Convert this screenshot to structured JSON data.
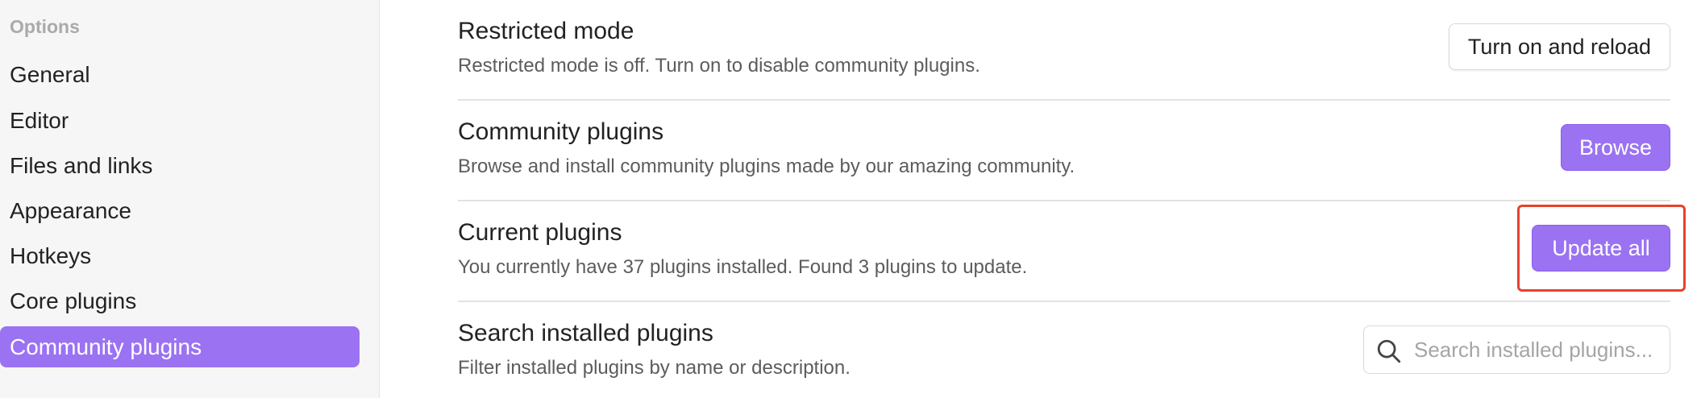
{
  "sidebar": {
    "heading": "Options",
    "items": [
      {
        "label": "General"
      },
      {
        "label": "Editor"
      },
      {
        "label": "Files and links"
      },
      {
        "label": "Appearance"
      },
      {
        "label": "Hotkeys"
      },
      {
        "label": "Core plugins"
      },
      {
        "label": "Community plugins",
        "active": true
      }
    ]
  },
  "settings": {
    "restricted_mode": {
      "title": "Restricted mode",
      "description": "Restricted mode is off. Turn on to disable community plugins.",
      "button_label": "Turn on and reload"
    },
    "community_plugins": {
      "title": "Community plugins",
      "description": "Browse and install community plugins made by our amazing community.",
      "button_label": "Browse"
    },
    "current_plugins": {
      "title": "Current plugins",
      "description": "You currently have 37 plugins installed. Found 3 plugins to update.",
      "button_label": "Update all"
    },
    "search_installed": {
      "title": "Search installed plugins",
      "description": "Filter installed plugins by name or description.",
      "placeholder": "Search installed plugins...",
      "value": ""
    }
  },
  "colors": {
    "accent": "#9b72f2",
    "highlight": "#e8412c",
    "sidebar_bg": "#f6f6f6"
  },
  "icons": {
    "search": "search-icon"
  }
}
